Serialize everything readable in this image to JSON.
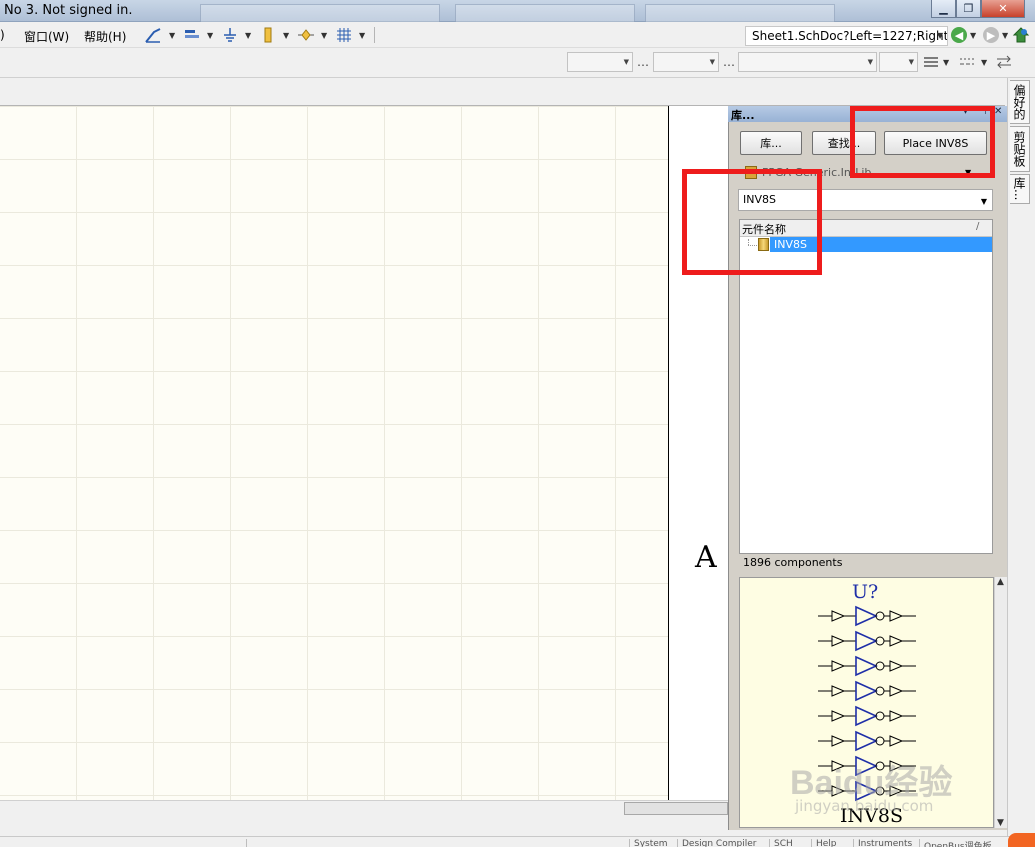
{
  "window": {
    "title": "No 3. Not signed in.",
    "controls": {
      "minimize": "▁",
      "maximize": "❐",
      "close": "✕"
    }
  },
  "menu": {
    "items": [
      ")",
      "窗口(W)",
      "帮助(H)"
    ]
  },
  "toolbar": {
    "address": "Sheet1.SchDoc?Left=1227;Right",
    "back_icon": "back-arrow-icon",
    "forward_icon": "forward-arrow-icon",
    "home_icon": "home-icon"
  },
  "canvas": {
    "zone_letter": "A"
  },
  "library_panel": {
    "title": "库...",
    "buttons": {
      "libraries": "库...",
      "search": "查找...",
      "place": "Place INV8S"
    },
    "library_select": "FPGA Generic.IntLib",
    "filter_value": "INV8S",
    "column_header": "元件名称",
    "column_sort": "/",
    "components": [
      {
        "name": "INV8S",
        "selected": true
      }
    ],
    "count_text": "1896 components",
    "preview": {
      "designator": "U?",
      "comment": "INV8S",
      "gate_count": 8
    }
  },
  "side_tabs": [
    "偏好的",
    "剪贴板",
    "库..."
  ],
  "status_bar": [
    "System",
    "Design Compiler",
    "SCH",
    "Help",
    "Instruments",
    "OpenBus调色板"
  ],
  "watermark": {
    "line1": "Baidu经验",
    "line2": "jingyan.baidu.com"
  },
  "colors": {
    "selection": "#3399ff",
    "highlight_box": "#ee1c1c",
    "schematic_blue": "#1f2fa8",
    "canvas_bg": "#fefdf6",
    "preview_bg": "#fefde3"
  }
}
